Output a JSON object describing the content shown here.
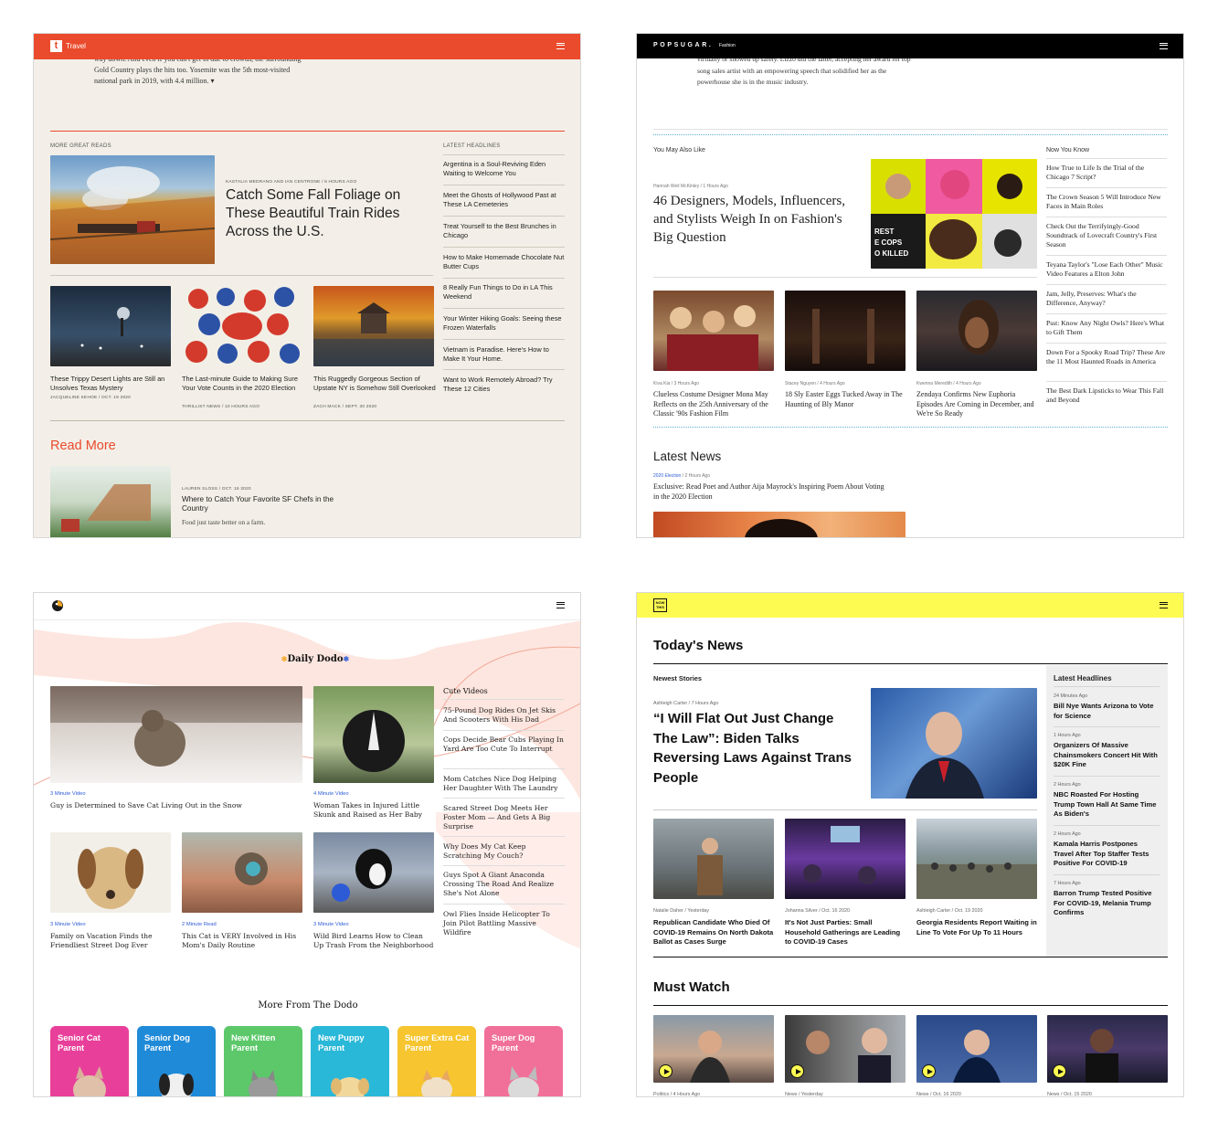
{
  "colors": {
    "travel_accent": "#ea4b2d",
    "popsugar_bar": "#000000",
    "dodo_link": "#2d5bd6",
    "nowthis_yellow": "#fdfa52"
  },
  "travel": {
    "header": {
      "logo": "t",
      "section": "Travel",
      "menu_icon": "hamburger-icon"
    },
    "intro": [
      "way down. And even if you can't get in due to crowds, the surrounding",
      "Gold Country plays the hits too. Yosemite was the 5th most-visited",
      "national park in 2019, with 4.4 million. ▾"
    ],
    "more_label": "MORE GREAT READS",
    "feature": {
      "meta": "KASTALIA MEDRANO AND IAN CENTRONE / 6 HOURS AGO",
      "title": "Catch Some Fall Foliage on These Beautiful Train Rides Across the U.S."
    },
    "cards": [
      {
        "title": "These Trippy Desert Lights are Still an Unsolves Texas Mystery",
        "meta": "JACQUELINE KEHOE / OCT. 19 2020"
      },
      {
        "title": "The Last-minute Guide to Making Sure Your Vote Counts in the 2020 Election",
        "meta": "THRILLIST NEWS / 10 HOURS AGO"
      },
      {
        "title": "This Ruggedly Gorgeous Section of Upstate NY is Somehow Still Overlooked",
        "meta": "ZACH MACK / SEPT. 30 2020"
      }
    ],
    "latest_label": "LATEST HEADLINES",
    "latest": [
      "Argentina is a Soul-Reviving Eden Waiting to Welcome You",
      "Meet the Ghosts of Hollywood Past at These LA Cemeteries",
      "Treat Yourself to the Best Brunches in Chicago",
      "How to Make Homemade Chocolate Nut Butter Cups",
      "8 Really Fun Things to Do in LA This Weekend",
      "Your Winter Hiking Goals: Seeing these Frozen Waterfalls",
      "Vietnam is Paradise. Here's How to Make It Your Home.",
      "Want to Work Remotely Abroad? Try These 12 Cities"
    ],
    "read_more": "Read More",
    "bottom": {
      "meta": "LAUREN SLOSS / OCT. 16 2020",
      "title": "Where to Catch Your Favorite SF Chefs in the Country",
      "dek": "Food just taste better on a farm."
    }
  },
  "popsugar": {
    "header": {
      "logo": "POPSUGAR.",
      "section": "Fashion",
      "menu_icon": "hamburger-icon"
    },
    "intro": [
      "virtually or showed up safely. Lizzo did the latter, accepting her award for top",
      "song sales artist with an empowering speech that solidified her as the",
      "powerhouse she is in the music industry."
    ],
    "also_label": "You May Also Like",
    "feature": {
      "meta": "Hannah Weil McKinley / 1 Hours Ago",
      "title": "46 Designers, Models, Influencers, and Stylists Weigh In on Fashion's Big Question"
    },
    "cards": [
      {
        "meta": "Kiva Kia / 3 Hours Ago",
        "title": "Clueless Costume Designer Mona May Reflects on the 25th Anniversary of the Classic '90s Fashion Film"
      },
      {
        "meta": "Stacey Nguyen / 4 Hours Ago",
        "title": "18 Sly Easter Eggs Tucked Away in The Haunting of Bly Manor"
      },
      {
        "meta": "Kwenna Meredith / 4 Hours Ago",
        "title": "Zendaya Confirms New Euphoria Episodes Are Coming in December, and We're So Ready"
      }
    ],
    "nyk_label": "Now You Know",
    "nyk": [
      "How True to Life Is the Trial of the Chicago 7 Script?",
      "The Crown Season 5 Will Introduce New Faces in Main Roles",
      "Check Out the Terrifyingly-Good Soundtrack of Lovecraft Country's First Season",
      "Teyana Taylor's \"Lose Each Other\" Music Video Features a Elton John",
      "Jam, Jelly, Preserves: What's the Difference, Anyway?",
      "Psst: Know Any Night Owls? Here's What to Gift Them",
      "Down For a Spooky Road Trip? These Are the 11 Most Haunted Roads in America",
      "The Best Dark Lipsticks to Wear This Fall and Beyond"
    ],
    "latest_label": "Latest News",
    "latest_meta_tag": "2020 Election",
    "latest_meta_time": " / 2 Hours Ago",
    "latest_title": "Exclusive: Read Poet and Author Aija Mayrock's Inspiring Poem About Voting in the 2020 Election"
  },
  "dodo": {
    "header": {
      "logo_icon": "dodo-bird-icon",
      "menu_icon": "hamburger-icon"
    },
    "title": "Daily Dodo",
    "feature": {
      "meta": "3 Minute Video",
      "title": "Guy is Determined to Save Cat Living Out in the Snow"
    },
    "side_card": {
      "meta": "4 Minute Video",
      "title": "Woman Takes in Injured Little Skunk and Raised as Her Baby"
    },
    "cards": [
      {
        "meta": "3 Minute Video",
        "title": "Family on Vacation Finds the Friendliest Street Dog Ever"
      },
      {
        "meta": "2 Minute Read",
        "title": "This Cat is VERY Involved in His Mom's Daily Routine"
      },
      {
        "meta": "3 Minute Video",
        "title": "Wild Bird Learns How to Clean Up Trash From the Neighborhood"
      }
    ],
    "cute_label": "Cute Videos",
    "cute": [
      "75-Pound Dog Rides On Jet Skis And Scooters With His Dad",
      "Cops Decide Bear Cubs Playing In Yard Are Too Cute To Interrupt",
      "Mom Catches Nice Dog Helping Her Daughter With The Laundry",
      "Scared Street Dog Meets Her Foster Mom — And Gets A Big Surprise",
      "Why Does My Cat Keep Scratching My Couch?",
      "Guys Spot A Giant Anaconda Crossing The Road And Realize She's Not Alone",
      "Owl Flies Inside Helicopter To Join Pilot Battling Massive Wildfire"
    ],
    "more_label": "More From The Dodo",
    "more": [
      {
        "label": "Senior Cat Parent",
        "color": "#e8409a"
      },
      {
        "label": "Senior Dog Parent",
        "color": "#1f8ad8"
      },
      {
        "label": "New Kitten Parent",
        "color": "#5cc86a"
      },
      {
        "label": "New Puppy Parent",
        "color": "#2ab8d8"
      },
      {
        "label": "Super Extra Cat Parent",
        "color": "#f6c530"
      },
      {
        "label": "Super Dog Parent",
        "color": "#f0709a"
      }
    ]
  },
  "nowthis": {
    "header": {
      "logo": "NOW THIS",
      "menu_icon": "hamburger-icon"
    },
    "title": "Today's News",
    "newest_label": "Newest Stories",
    "feature": {
      "meta": "Ashleigh Carter / 7 Hours Ago",
      "title": "“I Will Flat Out Just Change The Law”: Biden Talks Reversing Laws Against Trans People"
    },
    "cards": [
      {
        "meta": "Natalie Daher / Yesterday",
        "title": "Republican Candidate Who Died Of COVID-19 Remains On North Dakota Ballot as Cases Surge"
      },
      {
        "meta": "Johanna Silver / Oct. 16 2020",
        "title": "It's Not Just Parties: Small Household Gatherings are Leading to COVID-19 Cases"
      },
      {
        "meta": "Ashleigh Carter / Oct. 19 2020",
        "title": "Georgia Residents Report Waiting in Line To Vote For Up To 11 Hours"
      }
    ],
    "latest_label": "Latest Headlines",
    "latest": [
      {
        "meta": "24 Minutes Ago",
        "title": "Bill Nye Wants Arizona to Vote for Science"
      },
      {
        "meta": "1 Hours Ago",
        "title": "Organizers Of Massive Chainsmokers Concert Hit With $20K Fine"
      },
      {
        "meta": "2 Hours Ago",
        "title": "NBC Roasted For Hosting Trump Town Hall At Same Time As Biden's"
      },
      {
        "meta": "2 Hours Ago",
        "title": "Kamala Harris Postpones Travel After Top Staffer Tests Positive For COVID-19"
      },
      {
        "meta": "7 Hours Ago",
        "title": "Barron Trump Tested Positive For COVID-19, Melania Trump Confirms"
      }
    ],
    "must_label": "Must Watch",
    "must": [
      {
        "meta": "Politics / 4 Hours Ago"
      },
      {
        "meta": "News / Yesterday"
      },
      {
        "meta": "News / Oct. 16 2020"
      },
      {
        "meta": "News / Oct. 15 2020"
      }
    ]
  }
}
